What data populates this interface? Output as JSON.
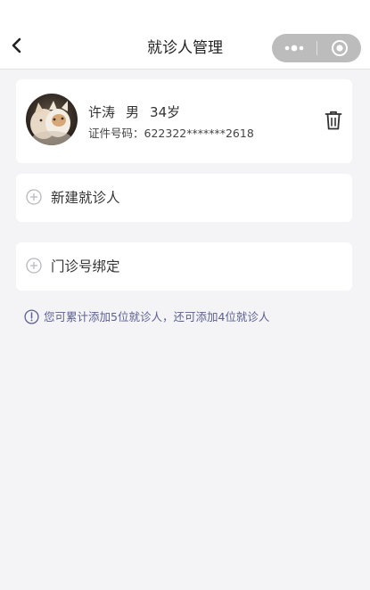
{
  "nav": {
    "title": "就诊人管理",
    "back_icon": "chevron-left-icon",
    "more_icon": "more-dots-icon",
    "close_icon": "target-circle-icon"
  },
  "patients": [
    {
      "name": "许涛",
      "gender": "男",
      "age": "34岁",
      "id_label": "证件号码：",
      "id_number": "622322*******2618",
      "avatar_icon": "cat-photo-avatar",
      "delete_icon": "trash-icon"
    }
  ],
  "actions": {
    "new_patient": {
      "label": "新建就诊人",
      "icon": "plus-circle-icon"
    },
    "bind_outpatient": {
      "label": "门诊号绑定",
      "icon": "plus-circle-icon"
    }
  },
  "notice": {
    "icon": "info-circle-icon",
    "text": "您可累计添加5位就诊人，还可添加4位就诊人"
  },
  "colors": {
    "page_bg": "#f4f4f6",
    "card_bg": "#ffffff",
    "notice_text": "#5b5f93",
    "capsule_bg": "#bcbcbc"
  }
}
